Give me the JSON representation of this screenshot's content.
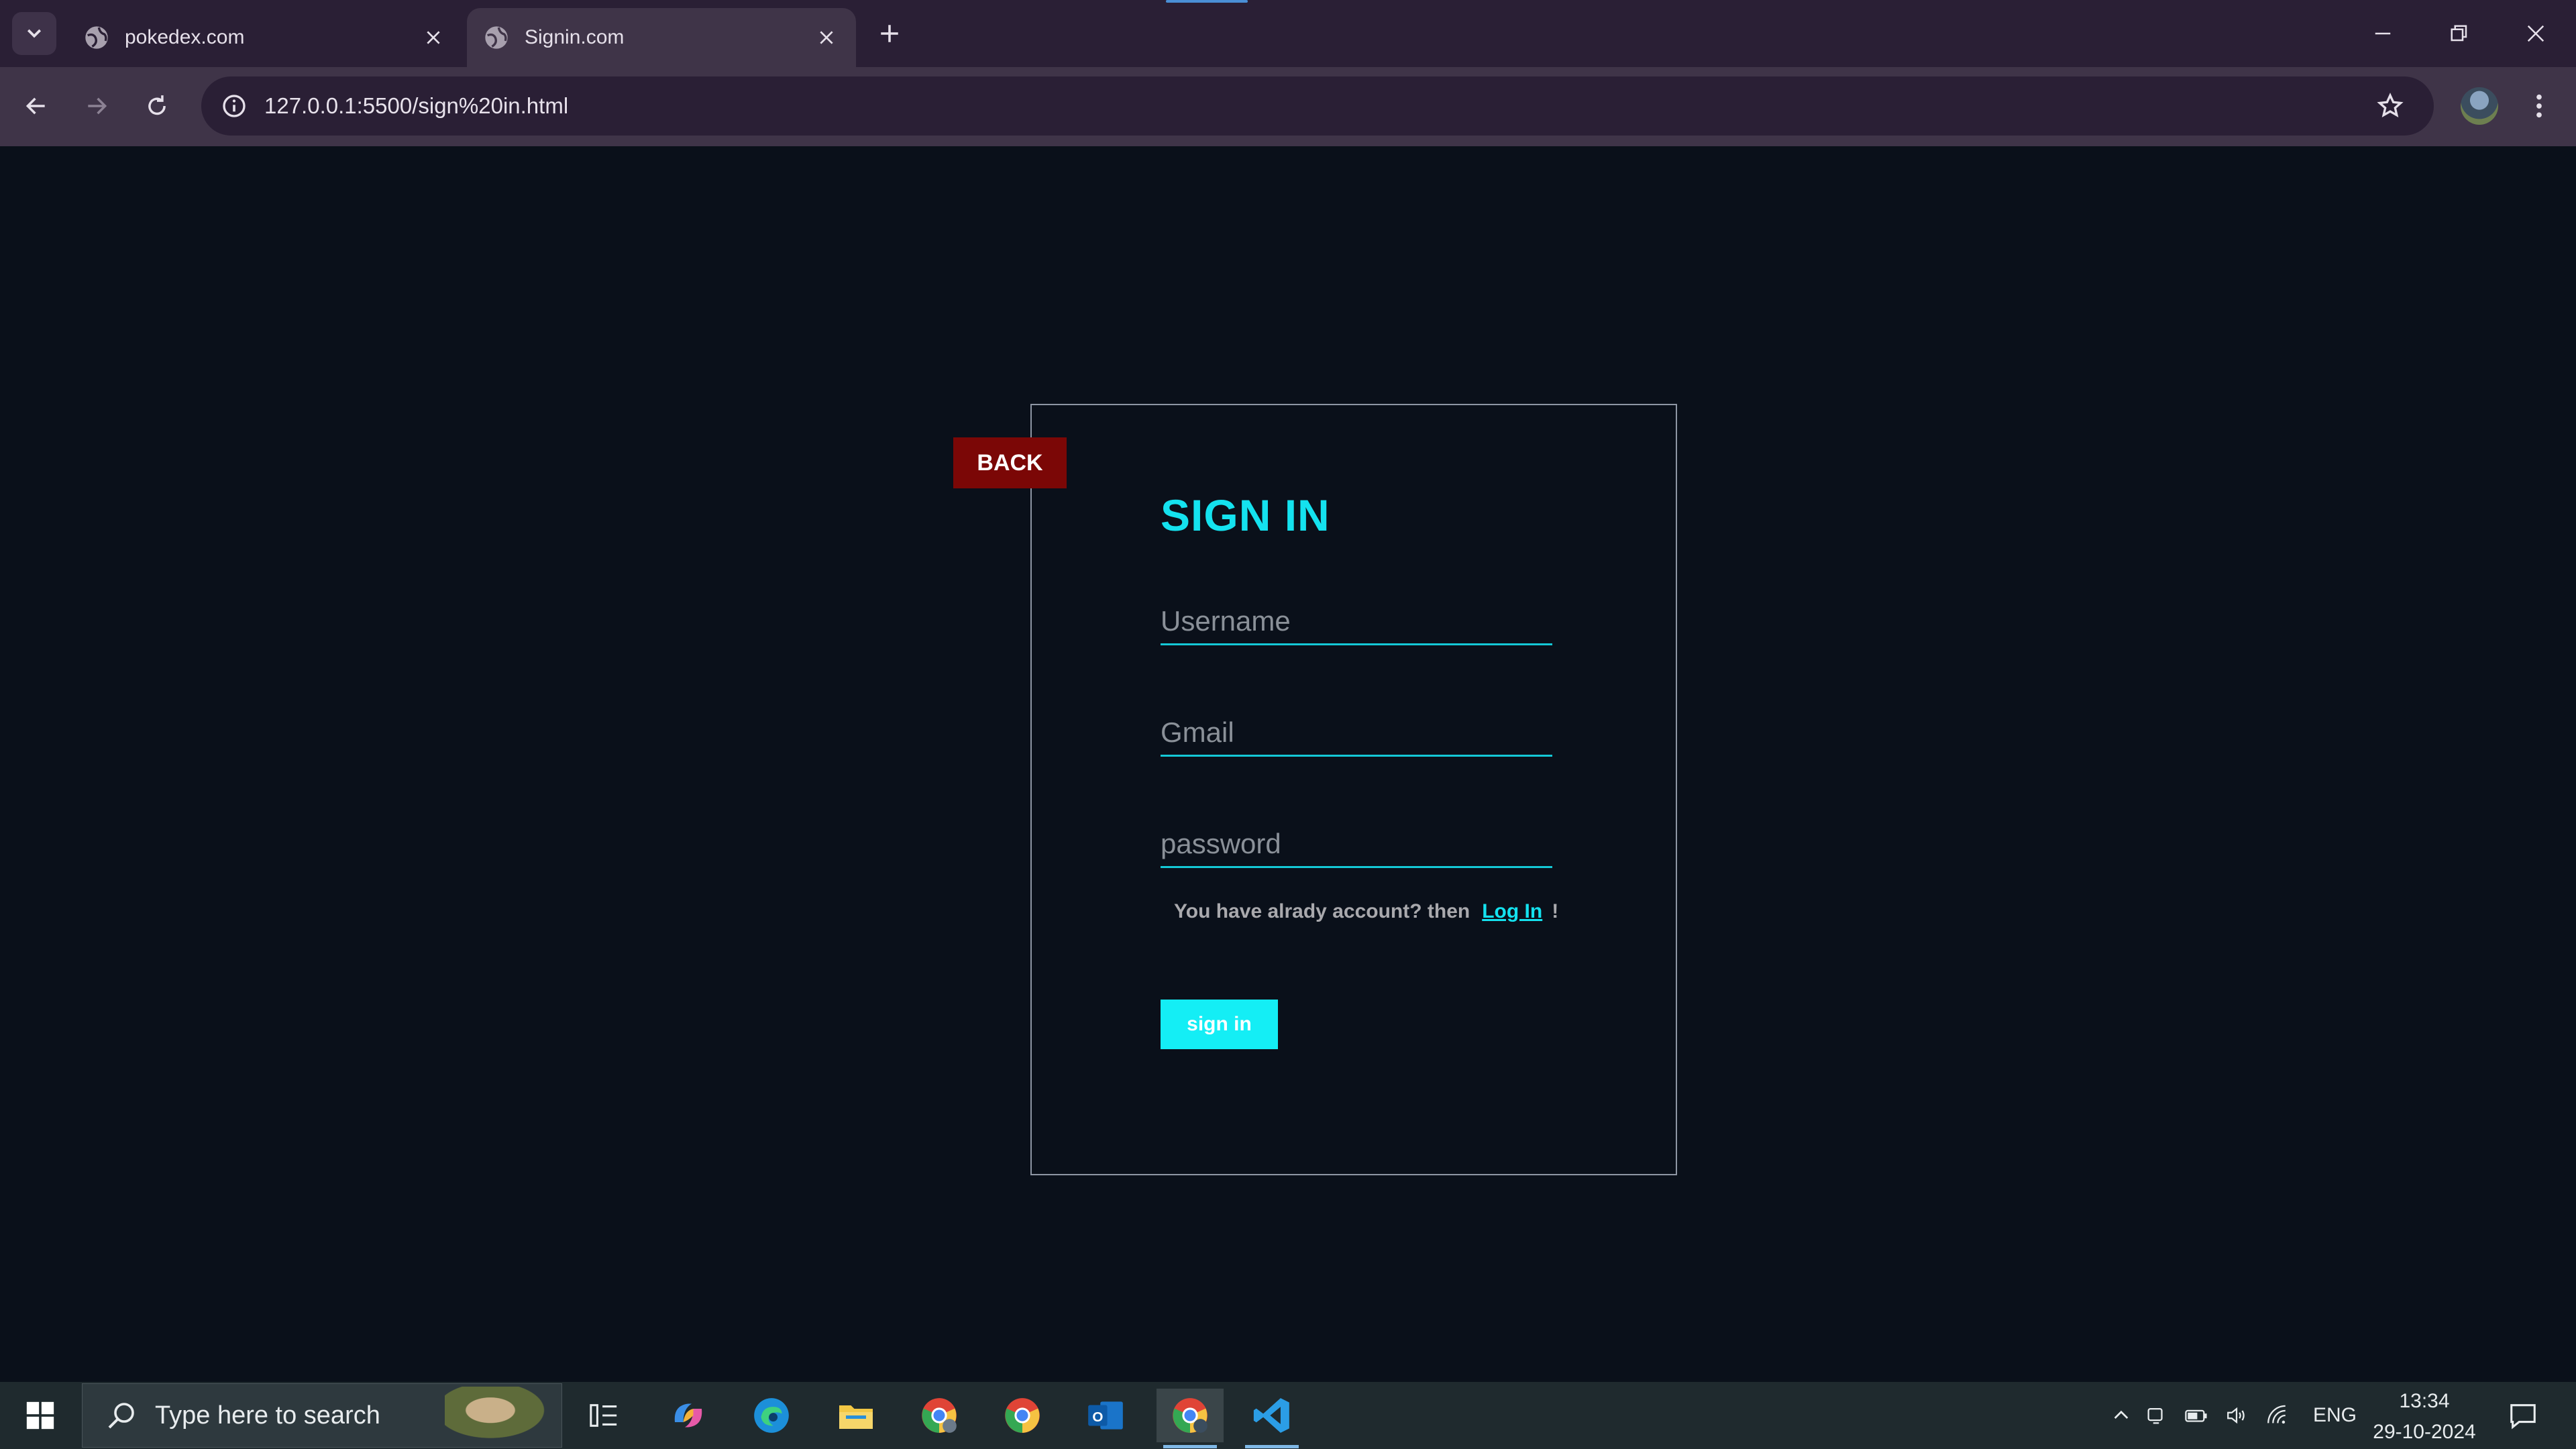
{
  "browser": {
    "tabs": [
      {
        "title": "pokedex.com"
      },
      {
        "title": "Signin.com"
      }
    ],
    "address": "127.0.0.1:5500/sign%20in.html"
  },
  "page": {
    "back_label": "BACK",
    "heading": "SIGN IN",
    "username_placeholder": "Username",
    "gmail_placeholder": "Gmail",
    "password_placeholder": "password",
    "helper_text": "You have alrady account? then",
    "login_link": "Log In",
    "helper_suffix": "!",
    "signin_label": "sign in",
    "colors": {
      "background": "#0a101a",
      "accent": "#14e2ef",
      "back_button": "#7b0706"
    }
  },
  "taskbar": {
    "search_placeholder": "Type here to search",
    "language": "ENG",
    "time": "13:34",
    "date": "29-10-2024",
    "apps": [
      "task-view-icon",
      "copilot-icon",
      "edge-icon",
      "file-explorer-icon",
      "chrome-profile-icon",
      "chrome-icon",
      "outlook-icon",
      "chrome-active-icon",
      "vscode-icon"
    ]
  }
}
